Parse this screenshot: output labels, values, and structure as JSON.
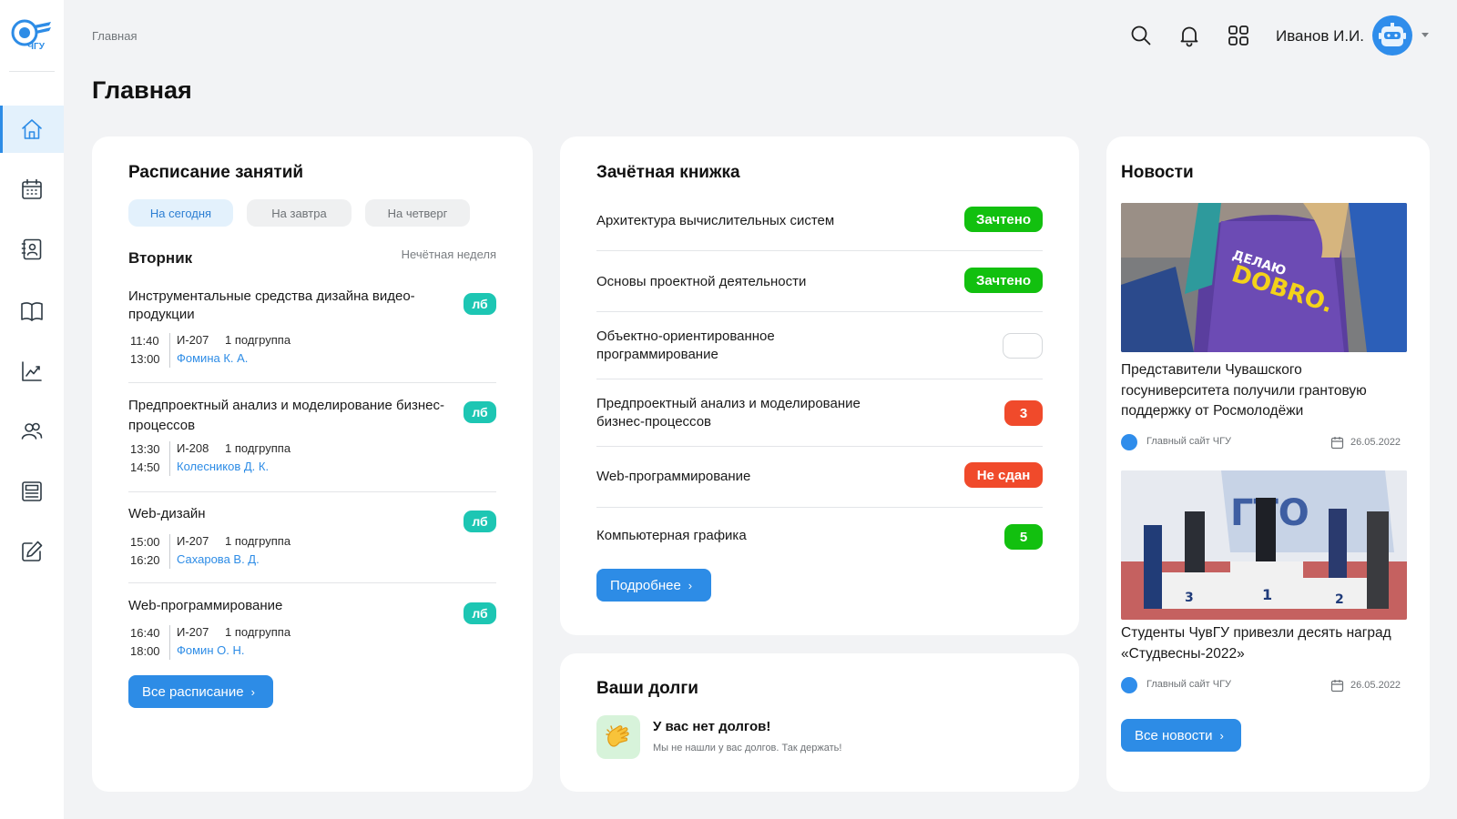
{
  "breadcrumb": "Главная",
  "page_title": "Главная",
  "header": {
    "user_name": "Иванов И.И.",
    "icons": [
      "search-icon",
      "bell-icon",
      "grid-icon"
    ]
  },
  "logo_text": "ЧГУ",
  "sidebar": {
    "items": [
      {
        "icon": "home-icon",
        "active": true
      },
      {
        "icon": "calendar-icon",
        "active": false
      },
      {
        "icon": "contacts-icon",
        "active": false
      },
      {
        "icon": "book-icon",
        "active": false
      },
      {
        "icon": "chart-icon",
        "active": false
      },
      {
        "icon": "users-icon",
        "active": false
      },
      {
        "icon": "news-icon",
        "active": false
      },
      {
        "icon": "edit-icon",
        "active": false
      }
    ]
  },
  "schedule": {
    "title": "Расписание занятий",
    "tabs": [
      "На сегодня",
      "На завтра",
      "На четверг"
    ],
    "active_tab": 0,
    "day": "Вторник",
    "week_type": "Нечётная неделя",
    "lessons": [
      {
        "title": "Инструментальные средства дизайна видео-продукции",
        "badge": "лб",
        "start": "11:40",
        "end": "13:00",
        "room": "И-207",
        "group": "1 подгруппа",
        "teacher": "Фомина К. А."
      },
      {
        "title": "Предпроектный анализ и моделирование бизнес-процессов",
        "badge": "лб",
        "start": "13:30",
        "end": "14:50",
        "room": "И-208",
        "group": "1 подгруппа",
        "teacher": "Колесников Д. К."
      },
      {
        "title": "Web-дизайн",
        "badge": "лб",
        "start": "15:00",
        "end": "16:20",
        "room": "И-207",
        "group": "1 подгруппа",
        "teacher": "Сахарова В. Д."
      },
      {
        "title": "Web-программирование",
        "badge": "лб",
        "start": "16:40",
        "end": "18:00",
        "room": "И-207",
        "group": "1 подгруппа",
        "teacher": "Фомин О. Н."
      }
    ],
    "button": "Все расписание"
  },
  "record_book": {
    "title": "Зачётная книжка",
    "rows": [
      {
        "subject": "Архитектура вычислительных систем",
        "grade": "Зачтено",
        "status": "green"
      },
      {
        "subject": "Основы проектной деятельности",
        "grade": "Зачтено",
        "status": "green"
      },
      {
        "subject": "Объектно-ориентированное программирование",
        "grade": "",
        "status": "empty"
      },
      {
        "subject": "Предпроектный анализ и моделирование бизнес-процессов",
        "grade": "3",
        "status": "red"
      },
      {
        "subject": "Web-программирование",
        "grade": "Не сдан",
        "status": "red"
      },
      {
        "subject": "Компьютерная графика",
        "grade": "5",
        "status": "green"
      }
    ],
    "button": "Подробнее"
  },
  "debts": {
    "title": "Ваши долги",
    "headline": "У вас нет долгов!",
    "subtext": "Мы не нашли у вас долгов. Так держать!",
    "icon": "clapping-hands-icon"
  },
  "news": {
    "title": "Новости",
    "items": [
      {
        "title": "Представители Чувашского госуниверситета получили грантовую поддержку от Росмолодёжи",
        "source": "Главный сайт ЧГУ",
        "date": "26.05.2022",
        "image_text": "ДЕЛАЮ DOBRO.РФ"
      },
      {
        "title": "Студенты ЧувГУ привезли десять наград «Студвесны-2022»",
        "source": "Главный сайт ЧГУ",
        "date": "26.05.2022",
        "image_text": "ГТО"
      }
    ],
    "button": "Все новости"
  },
  "colors": {
    "accent": "#2D8CE6",
    "green": "#12C00F",
    "red": "#F04A2B",
    "teal": "#1DC6B3",
    "background": "#F2F3F5"
  }
}
